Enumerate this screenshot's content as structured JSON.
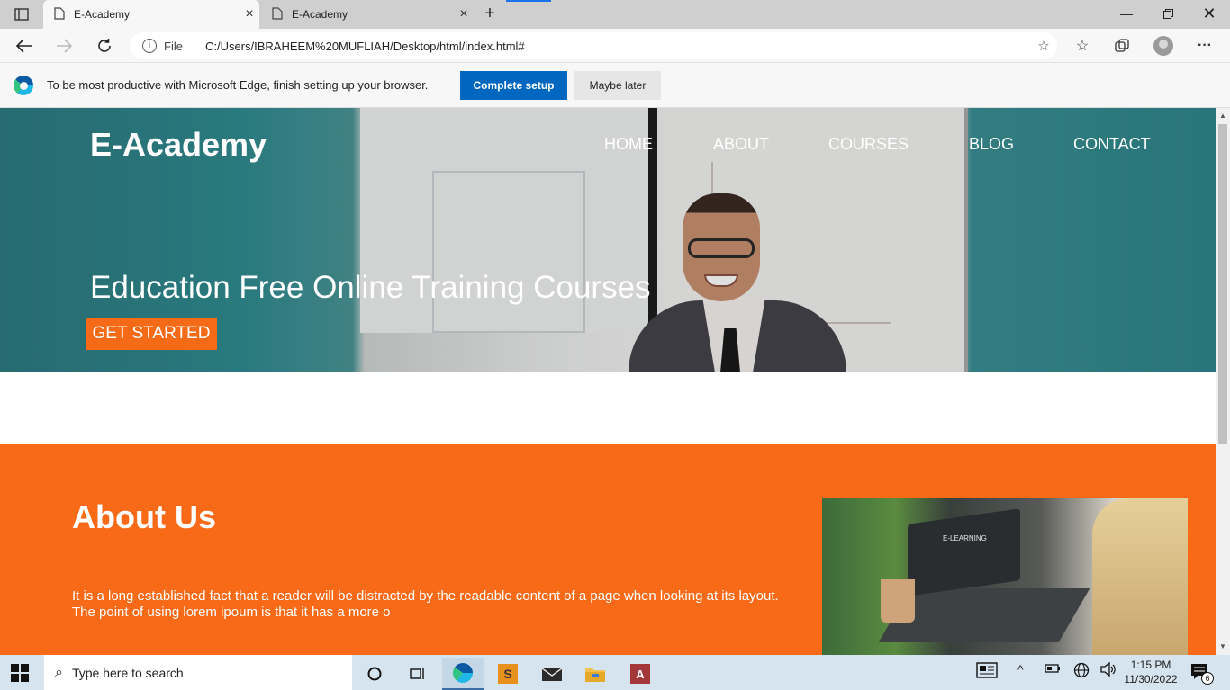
{
  "browser": {
    "tabs": [
      {
        "title": "E-Academy",
        "active": true
      },
      {
        "title": "E-Academy",
        "active": false
      }
    ],
    "new_tab_label": "+",
    "address": {
      "scheme_label": "File",
      "url": "C:/Users/IBRAHEEM%20MUFLIAH/Desktop/html/index.html#"
    },
    "infobar": {
      "message": "To be most productive with Microsoft Edge, finish setting up your browser.",
      "primary_button": "Complete setup",
      "secondary_button": "Maybe later"
    }
  },
  "page": {
    "brand": "E-Academy",
    "nav": [
      "HOME",
      "ABOUT",
      "COURSES",
      "BLOG",
      "CONTACT"
    ],
    "hero_title": "Education Free Online Training Courses",
    "cta": "GET STARTED",
    "about_title": "About Us",
    "about_text": "It is a long established fact that a reader will be distracted by the readable content of a page when looking at its layout. The point of using lorem ipoum is that it has a more o",
    "about_image_caption": "E-LEARNING",
    "colors": {
      "accent": "#f86a17",
      "button": "#f56a16",
      "edge_blue": "#0067c0"
    }
  },
  "taskbar": {
    "search_placeholder": "Type here to search",
    "time": "1:15 PM",
    "date": "11/30/2022",
    "notification_count": "6"
  }
}
